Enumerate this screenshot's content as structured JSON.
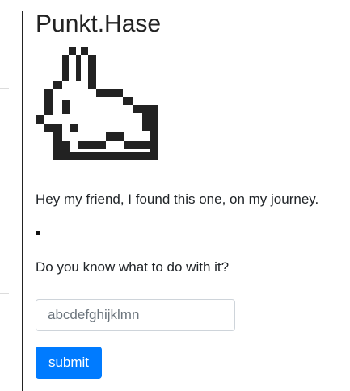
{
  "header": {
    "title": "Punkt.Hase"
  },
  "content": {
    "message": "Hey my friend, I found this one, on my journey.",
    "question": "Do you know what to do with it?"
  },
  "form": {
    "code_placeholder": "abcdefghijklmn",
    "code_value": "",
    "submit_label": "submit"
  },
  "icons": {
    "logo": "pixel-bunny-icon",
    "hidden_mark": "small-black-square"
  },
  "colors": {
    "accent": "#007bff",
    "pixel_art": "#222222",
    "divider": "#e3e3e3"
  }
}
